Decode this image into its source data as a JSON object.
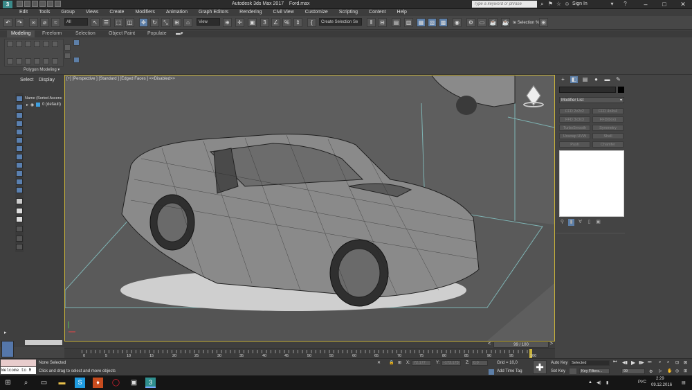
{
  "window": {
    "title": "Autodesk 3ds Max 2017",
    "filename": "Ford.max",
    "search_placeholder": "Type a keyword or phrase",
    "signin": "Sign In",
    "minimize": "–",
    "maximize": "□",
    "close": "✕"
  },
  "menu": [
    "Edit",
    "Tools",
    "Group",
    "Views",
    "Create",
    "Modifiers",
    "Animation",
    "Graph Editors",
    "Rendering",
    "Civil View",
    "Customize",
    "Scripting",
    "Content",
    "Help"
  ],
  "toolbar": {
    "filter": "All",
    "refcoord": "View",
    "selection_set": "Create Selection Se",
    "snap_three": "3",
    "selection_text": "te Selection %"
  },
  "ribbon": {
    "tabs": [
      "Modeling",
      "Freeform",
      "Selection",
      "Object Paint",
      "Populate"
    ],
    "active_tab": "Modeling",
    "panel_label": "Polygon Modeling ▾"
  },
  "scene_explorer": {
    "tabs": [
      "Select",
      "Display"
    ],
    "column": "Name (Sorted Ascenc",
    "layer": "0 (default)"
  },
  "viewport": {
    "label": "[+] [Perspective ] [Standard ] [Edged Faces ]  <<Disabled>>"
  },
  "command_panel": {
    "modifier_list": "Modifier List",
    "modifiers": [
      [
        "FFD 2x2x2",
        "FFD 4x4x4"
      ],
      [
        "FFD 3x3x3",
        "FFD(box)"
      ],
      [
        "TurboSmooth",
        "Symmetry"
      ],
      [
        "Unwrap UVW",
        "Shell"
      ],
      [
        "Push",
        "Chamfer"
      ]
    ]
  },
  "timeline": {
    "slider": "99 / 100",
    "ticks": [
      "0",
      "5",
      "10",
      "15",
      "20",
      "25",
      "30",
      "35",
      "40",
      "45",
      "50",
      "55",
      "60",
      "65",
      "70",
      "75",
      "80",
      "85",
      "90",
      "95",
      "100"
    ]
  },
  "status": {
    "welcome": "",
    "welcome_text": "Welcome to M",
    "selection": "None Selected",
    "prompt": "Click and drag to select and move objects",
    "x_label": "X:",
    "x_value": "72.177",
    "y_label": "Y:",
    "y_value": "-173.173",
    "z_label": "Z:",
    "z_value": "0.0",
    "grid": "Grid = 10,0",
    "add_time_tag": "Add Time Tag",
    "auto_key": "Auto Key",
    "auto_key_value": "Selected",
    "set_key": "Set Key",
    "key_filters": "Key Filters...",
    "frame": "99"
  },
  "taskbar": {
    "lang": "РУС",
    "time": "2:29",
    "date": "09.12.2016"
  }
}
